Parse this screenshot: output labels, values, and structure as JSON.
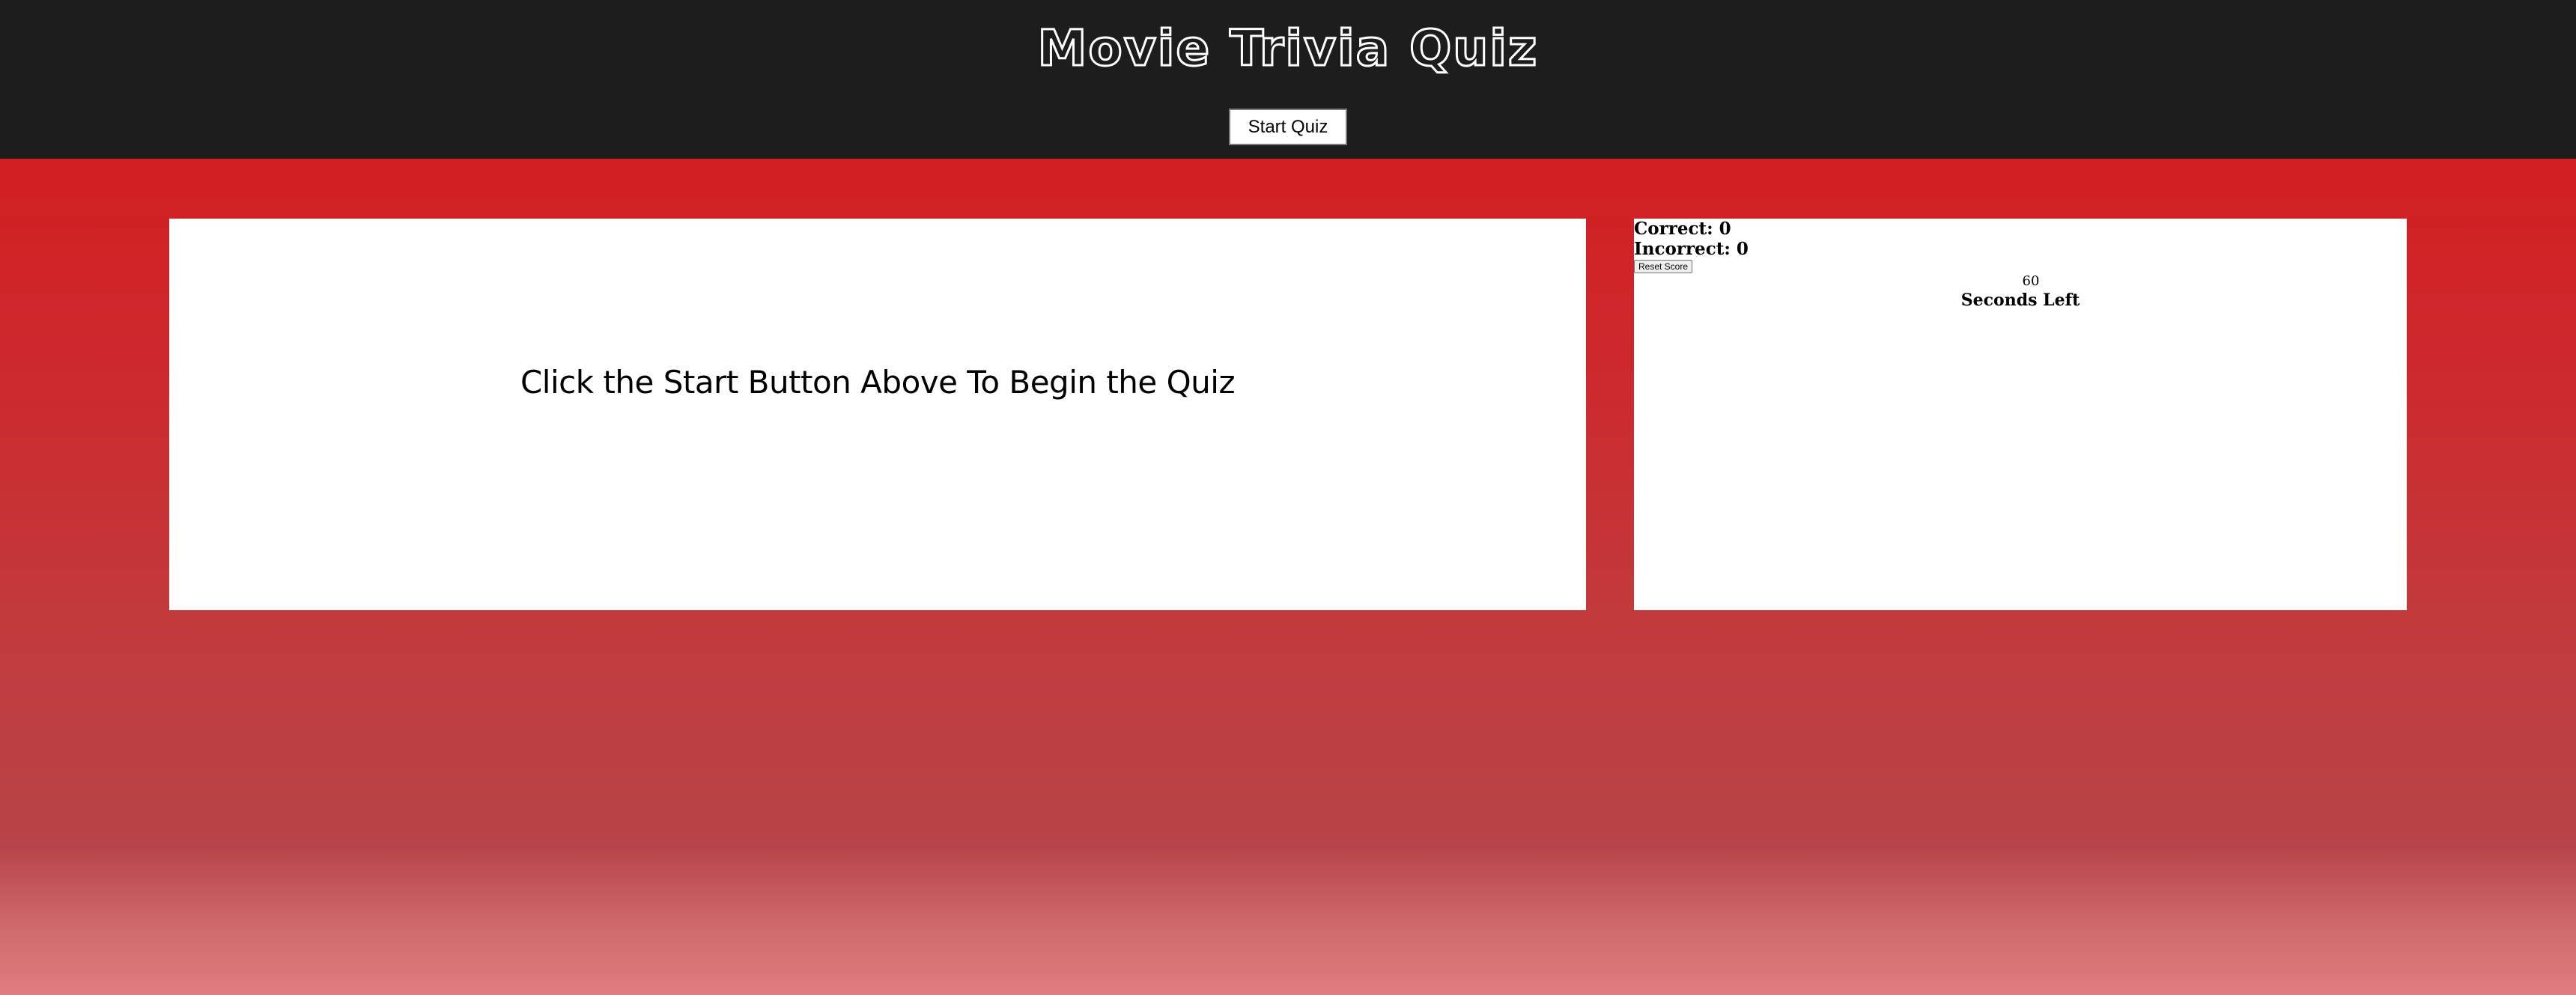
{
  "header": {
    "title": "Movie Trivia Quiz",
    "start_label": "Start Quiz"
  },
  "quiz": {
    "message": "Click the Start Button Above To Begin the Quiz"
  },
  "score": {
    "correct_text": "Correct: 0",
    "incorrect_text": "Incorrect: 0",
    "reset_label": "Reset Score"
  },
  "timer": {
    "seconds": "60",
    "label": "Seconds Left"
  },
  "colors": {
    "header_bg": "#1e1d1d",
    "page_gradient_top": "#d6181a",
    "page_gradient_bottom": "#e17d80",
    "panel_bg": "#ffffff"
  }
}
